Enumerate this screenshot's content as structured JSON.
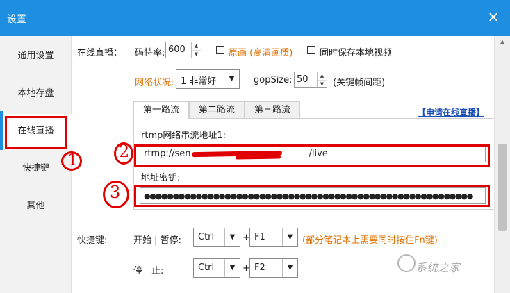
{
  "window": {
    "title": "设置",
    "close_icon": "×"
  },
  "sidebar": {
    "items": [
      {
        "label": "通用设置"
      },
      {
        "label": "本地存盘"
      },
      {
        "label": "在线直播"
      },
      {
        "label": "快捷键"
      },
      {
        "label": "其他"
      }
    ],
    "active_index": 2
  },
  "live": {
    "section_label": "在线直播：",
    "bitrate_label": "码特率:",
    "bitrate_value": "600",
    "original_quality_label": "原画 (高清画质)",
    "save_local_label": "同时保存本地视频",
    "network_label": "网络状况:",
    "network_value": "1 非常好",
    "gop_label": "gopSize:",
    "gop_value": "50",
    "gop_hint": "(关键帧间距)",
    "tabs": [
      {
        "label": "第一路流"
      },
      {
        "label": "第二路流"
      },
      {
        "label": "第三路流"
      }
    ],
    "apply_link": "【申请在线直播】",
    "rtmp_label": "rtmp网络串流地址1:",
    "rtmp_value": "rtmp://sen",
    "rtmp_suffix": "/live",
    "key_label": "地址密钥:",
    "key_value": "●●●●●●●●●●●●●●●●●●●●●●●●●●●●●●●●●●●●●●●●●●●●●●●●●●●●●●●●●"
  },
  "hotkeys": {
    "label": "快捷键:",
    "start_label": "开始 | 暂停:",
    "stop_label": "停　止:",
    "start_mod": "Ctrl",
    "start_key": "F1",
    "stop_mod": "Ctrl",
    "stop_key": "F2",
    "plus": "+",
    "note": "(部分笔记本上需要同时按住Fn键)"
  },
  "annotations": {
    "one": "1",
    "two": "2",
    "three": "3"
  },
  "watermark": {
    "text": "系统之家"
  },
  "colors": {
    "titlebar": "#1e8fe0",
    "annotation_red": "#e00000",
    "hint_orange": "#e07000",
    "link_blue": "#1a4fb5"
  }
}
